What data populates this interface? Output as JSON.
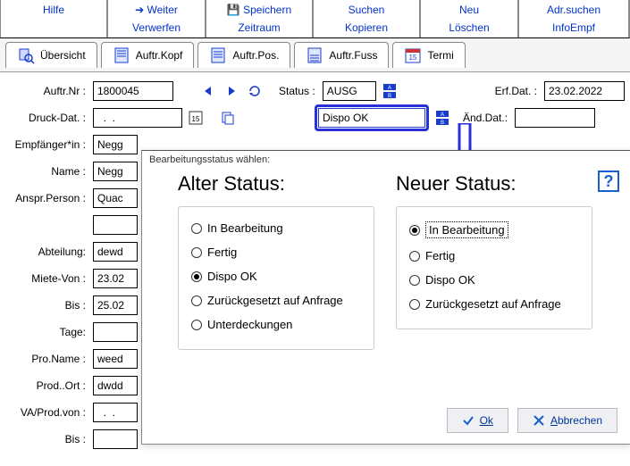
{
  "menubar": {
    "g1": {
      "a": "Hilfe"
    },
    "g2": {
      "a": "➔ Weiter",
      "b": "Verwerfen"
    },
    "g3": {
      "a": "💾 Speichern",
      "b": "Zeitraum"
    },
    "g4": {
      "a": "Suchen",
      "b": "Kopieren"
    },
    "g5": {
      "a": "Neu",
      "b": "Löschen"
    },
    "g6": {
      "a": "Adr.suchen",
      "b": "InfoEmpf"
    }
  },
  "tabs": {
    "t1": "Übersicht",
    "t2": "Auftr.Kopf",
    "t3": "Auftr.Pos.",
    "t4": "Auftr.Fuss",
    "t5": "Termi"
  },
  "form": {
    "auftr_nr_label": "Auftr.Nr :",
    "auftr_nr": "1800045",
    "status_label": "Status :",
    "status": "AUSG",
    "erf_dat_label": "Erf.Dat. :",
    "erf_dat": "23.02.2022",
    "druck_dat_label": "Druck-Dat. :",
    "druck_dat": "  .  .",
    "dispo_ok": "Dispo OK",
    "aend_dat_label": "Änd.Dat.:",
    "empf_label": "Empfänger*in :",
    "empf": "Negg",
    "name_label": "Name :",
    "name": "Negg",
    "anspr_label": "Anspr.Person :",
    "anspr": "Quac",
    "abteilung_label": "Abteilung:",
    "abteilung": "dewd",
    "miete_von_label": "Miete-Von :",
    "miete_von": "23.02",
    "bis_label": "Bis :",
    "bis": "25.02",
    "tage_label": "Tage:",
    "tage": "",
    "pro_name_label": "Pro.Name :",
    "pro_name": "weed",
    "prod_ort_label": "Prod..Ort :",
    "prod_ort": "dwdd",
    "va_prod_label": "VA/Prod.von :",
    "va_prod": "  .  .",
    "bis2_label": "Bis :"
  },
  "dialog": {
    "title": "Bearbeitungsstatus wählen:",
    "alter": {
      "head": "Alter Status:",
      "o1": "In Bearbeitung",
      "o2": "Fertig",
      "o3": "Dispo OK",
      "o4": "Zurückgesetzt auf Anfrage",
      "o5": "Unterdeckungen",
      "selected": "o3"
    },
    "neuer": {
      "head": "Neuer Status:",
      "o1": "In Bearbeitung",
      "o2": "Fertig",
      "o3": "Dispo OK",
      "o4": "Zurückgesetzt auf Anfrage",
      "selected": "o1"
    },
    "help": "?",
    "ok": "Ok",
    "cancel": "Abbrechen"
  }
}
